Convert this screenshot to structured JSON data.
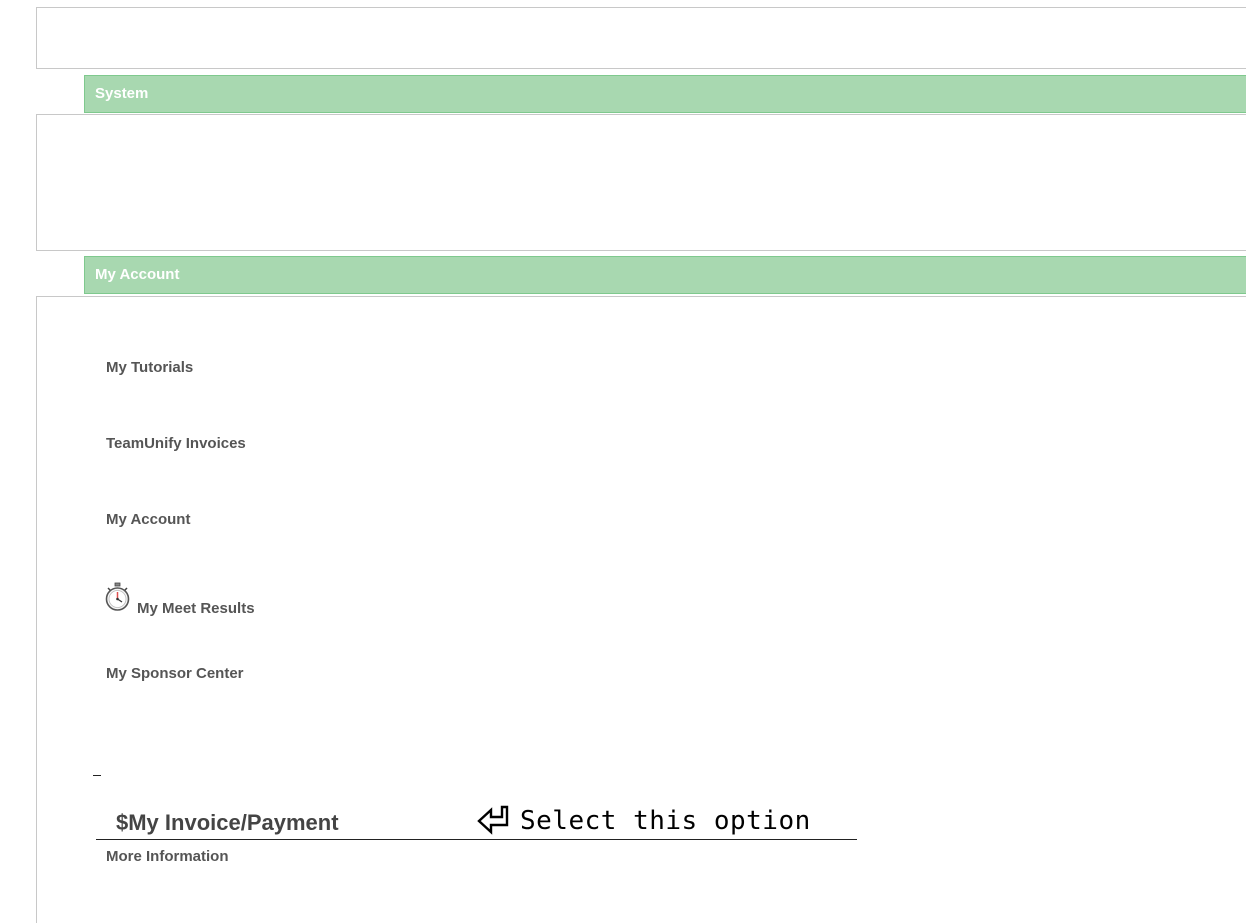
{
  "sections": {
    "system": {
      "title": "System"
    },
    "account": {
      "title": "My Account"
    }
  },
  "menu": {
    "tutorials": "My Tutorials",
    "invoices": "TeamUnify Invoices",
    "account": "My Account",
    "meet_results": "My Meet Results",
    "sponsor_center": "My Sponsor Center",
    "invoice_payment": "$My Invoice/Payment",
    "more_info": "More Information"
  },
  "annotation": {
    "text": "Select this option",
    "icon": "return-arrow-icon"
  },
  "icons": {
    "meet_results": "stopwatch-icon"
  },
  "colors": {
    "section_header_bg": "#a8d8b0",
    "section_header_border": "#7fc98e",
    "menu_text": "#555555"
  }
}
